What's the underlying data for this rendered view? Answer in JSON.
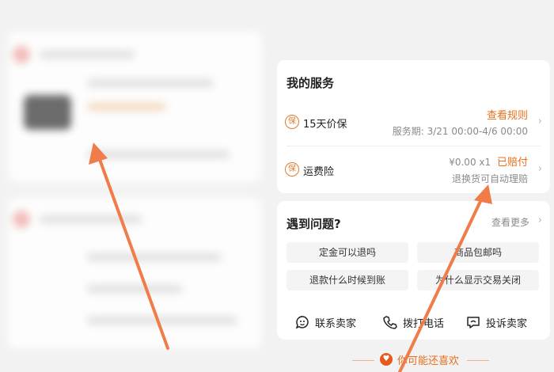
{
  "service": {
    "title": "我的服务",
    "items": [
      {
        "icon": "保",
        "name": "15天价保",
        "link": "查看规则",
        "detail": "服务期: 3/21 00:00-4/6 00:00"
      },
      {
        "icon": "保",
        "name": "运费险",
        "price": "¥0.00",
        "qty": "x1",
        "status": "已赔付",
        "detail": "退换货可自动理赔"
      }
    ]
  },
  "problems": {
    "title": "遇到问题?",
    "more": "查看更多",
    "chips": [
      "定金可以退吗",
      "商品包邮吗",
      "退款什么时候到账",
      "为什么显示交易关闭"
    ]
  },
  "actions": [
    {
      "label": "联系卖家",
      "icon": "chat-face-icon"
    },
    {
      "label": "拨打电话",
      "icon": "phone-icon"
    },
    {
      "label": "投诉卖家",
      "icon": "complaint-icon"
    }
  ],
  "recommend": {
    "label": "你可能还喜欢",
    "icon": "heart-icon"
  },
  "colors": {
    "accent": "#e8701c",
    "arrow": "#f07c4a"
  }
}
